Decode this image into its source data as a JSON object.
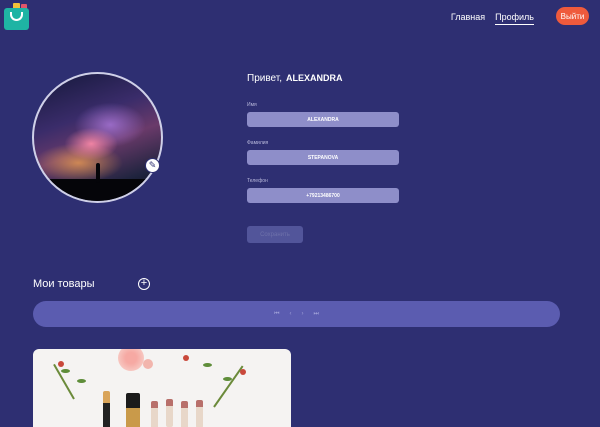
{
  "header": {
    "nav": [
      {
        "label": "Главная",
        "active": false
      },
      {
        "label": "Профиль",
        "active": true
      }
    ],
    "logout_label": "Выйти"
  },
  "profile": {
    "greeting": "Привет,",
    "name": "ALEXANDRA",
    "fields": [
      {
        "label": "Имя",
        "value": "ALEXANDRA"
      },
      {
        "label": "Фамилия",
        "value": "STEPANOVA"
      },
      {
        "label": "Телефон",
        "value": "+79213486700"
      }
    ],
    "save_label": "Сохранить"
  },
  "products": {
    "title": "Мои товары",
    "pager": [
      "⏮",
      "‹",
      "›",
      "⏭"
    ]
  },
  "colors": {
    "background": "#2e2f72",
    "accent": "#ef5a3c",
    "field": "#8e8ec9",
    "pager": "#5b5cb0"
  }
}
